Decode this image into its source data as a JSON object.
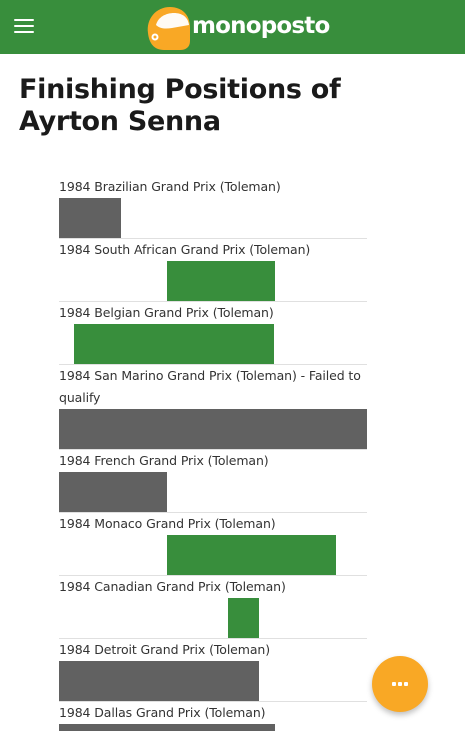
{
  "header": {
    "logo_text": "monoposto",
    "menu_icon": "hamburger-menu-icon",
    "logo_icon": "helmet-icon",
    "background": "#388e3c"
  },
  "page": {
    "title": "Finishing Positions of Ayrton Senna"
  },
  "colors": {
    "finished": "#388e3c",
    "retired": "#616161",
    "fab": "#f9a825"
  },
  "races": [
    {
      "label": "1984 Brazilian Grand Prix (Toleman)",
      "status": "dnf",
      "bar_start": 0.0,
      "bar_end": 0.2
    },
    {
      "label": "1984 South African Grand Prix (Toleman)",
      "status": "finish",
      "bar_start": 0.35,
      "bar_end": 0.7
    },
    {
      "label": "1984 Belgian Grand Prix (Toleman)",
      "status": "finish",
      "bar_start": 0.05,
      "bar_end": 0.7
    },
    {
      "label": "1984 San Marino Grand Prix (Toleman) - Failed to qualify",
      "status": "dnf",
      "bar_start": 0.0,
      "bar_end": 1.0
    },
    {
      "label": "1984 French Grand Prix (Toleman)",
      "status": "dnf",
      "bar_start": 0.0,
      "bar_end": 0.35
    },
    {
      "label": "1984 Monaco Grand Prix (Toleman)",
      "status": "finish",
      "bar_start": 0.35,
      "bar_end": 0.9
    },
    {
      "label": "1984 Canadian Grand Prix (Toleman)",
      "status": "finish",
      "bar_start": 0.55,
      "bar_end": 0.65
    },
    {
      "label": "1984 Detroit Grand Prix (Toleman)",
      "status": "dnf",
      "bar_start": 0.0,
      "bar_end": 0.65
    },
    {
      "label": "1984 Dallas Grand Prix (Toleman)",
      "status": "dnf",
      "bar_start": 0.0,
      "bar_end": 0.7
    }
  ],
  "fab": {
    "icon": "more-horizontal-icon"
  }
}
